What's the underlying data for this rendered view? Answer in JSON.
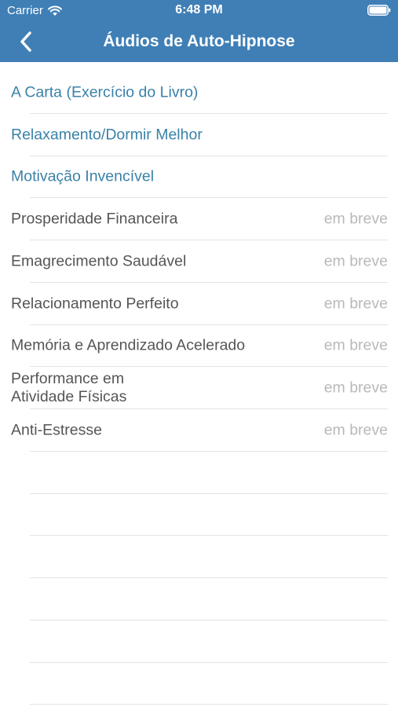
{
  "status_bar": {
    "carrier": "Carrier",
    "time": "6:48 PM"
  },
  "nav": {
    "title": "Áudios de Auto-Hipnose",
    "back_icon": "chevron-left-icon"
  },
  "colors": {
    "nav_bg": "#3f7fb6",
    "link_text": "#3a82a8",
    "disabled_text": "#555555",
    "badge_text": "#b9b9b9"
  },
  "items": [
    {
      "label": "A Carta (Exercício do Livro)",
      "status": ""
    },
    {
      "label": "Relaxamento/Dormir Melhor",
      "status": ""
    },
    {
      "label": "Motivação Invencível",
      "status": ""
    },
    {
      "label": "Prosperidade Financeira",
      "status": "em breve"
    },
    {
      "label": "Emagrecimento Saudável",
      "status": "em breve"
    },
    {
      "label": "Relacionamento Perfeito",
      "status": "em breve"
    },
    {
      "label": "Memória e Aprendizado Acelerado",
      "status": "em breve"
    },
    {
      "label": "Performance em\nAtividade Físicas",
      "status": "em breve"
    },
    {
      "label": "Anti-Estresse",
      "status": "em breve"
    }
  ]
}
